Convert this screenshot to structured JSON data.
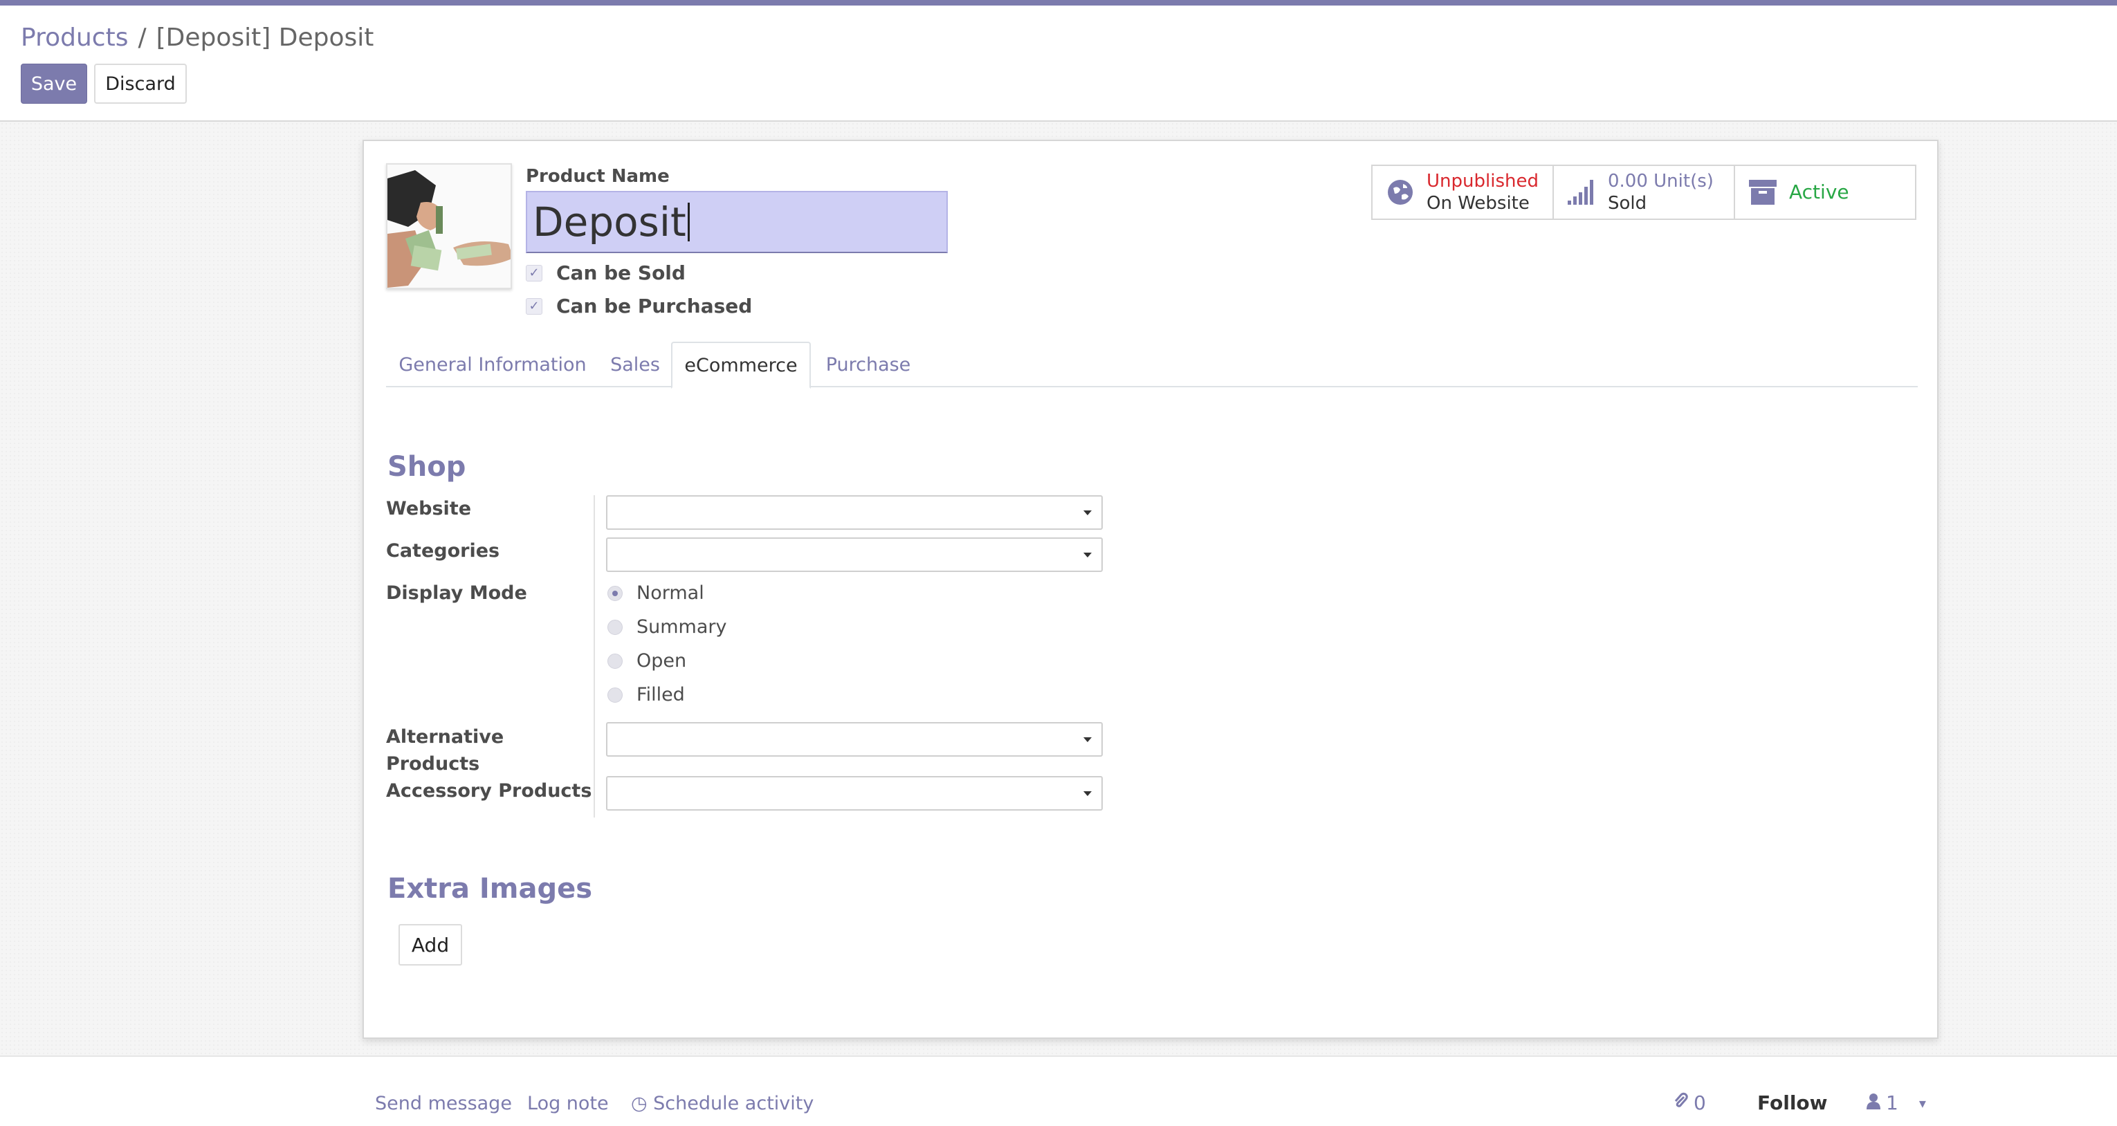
{
  "breadcrumb": {
    "parent": "Products",
    "separator": "/",
    "current": "[Deposit] Deposit"
  },
  "toolbar": {
    "save_label": "Save",
    "discard_label": "Discard"
  },
  "product": {
    "name_label": "Product Name",
    "name_value": "Deposit",
    "can_be_sold": {
      "label": "Can be Sold",
      "checked": true
    },
    "can_be_purchased": {
      "label": "Can be Purchased",
      "checked": true
    },
    "image_icon": "cash-handover-photo"
  },
  "smart_buttons": {
    "website": {
      "icon": "globe-icon",
      "line1": "Unpublished",
      "line2": "On Website"
    },
    "sold": {
      "icon": "signal-bars-icon",
      "line1": "0.00 Unit(s)",
      "line2": "Sold"
    },
    "active": {
      "icon": "archive-box-icon",
      "label": "Active"
    }
  },
  "tabs": [
    "General Information",
    "Sales",
    "eCommerce",
    "Purchase"
  ],
  "active_tab": "eCommerce",
  "shop": {
    "title": "Shop",
    "website_label": "Website",
    "website_value": "",
    "categories_label": "Categories",
    "categories_value": "",
    "display_mode_label": "Display Mode",
    "display_modes": [
      "Normal",
      "Summary",
      "Open",
      "Filled"
    ],
    "display_mode_selected": "Normal",
    "alternative_label_1": "Alternative",
    "alternative_label_2": "Products",
    "alternative_value": "",
    "accessory_label": "Accessory Products",
    "accessory_value": ""
  },
  "extra_images": {
    "title": "Extra Images",
    "add_label": "Add"
  },
  "chatter": {
    "send_message": "Send message",
    "log_note": "Log note",
    "schedule_activity": "Schedule activity",
    "attachments_count": "0",
    "follow_label": "Follow",
    "followers_count": "1"
  },
  "colors": {
    "brand": "#7c7bad",
    "unpublished": "#d9282e",
    "active": "#28a745",
    "input_focus": "#cfcff5"
  }
}
